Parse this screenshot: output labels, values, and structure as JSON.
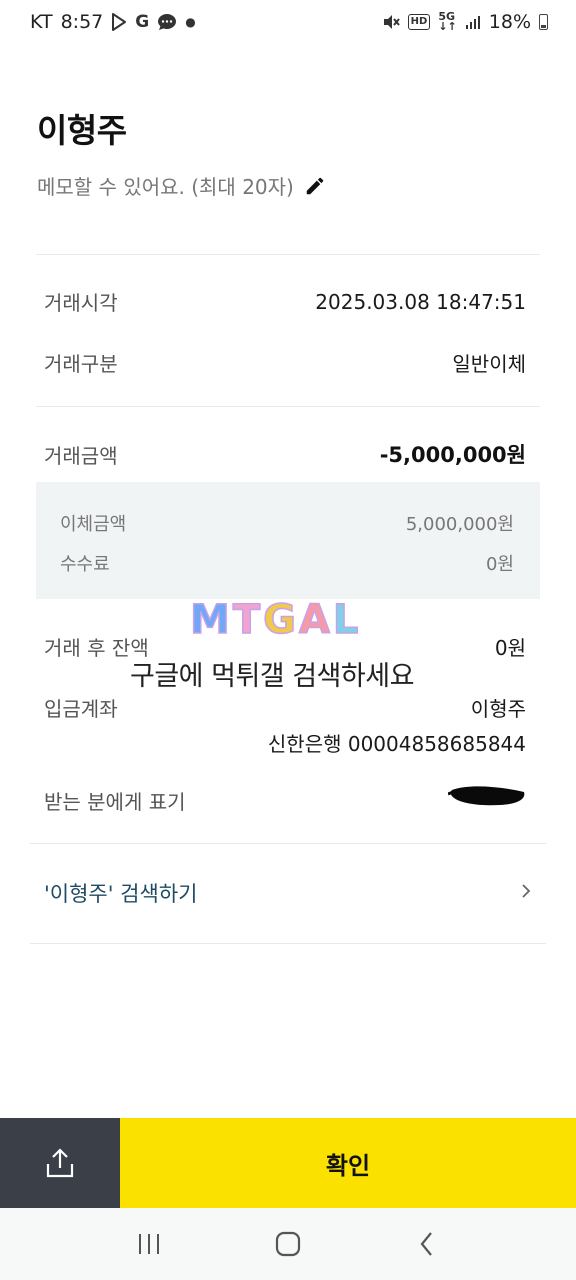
{
  "status_bar": {
    "carrier": "KT",
    "time": "8:57",
    "battery": "18%",
    "left_icons": [
      "play-store-icon",
      "google-icon",
      "message-icon"
    ],
    "right_icons": [
      "mute-icon",
      "hd-icon",
      "5g-icon",
      "signal-icon",
      "battery-icon"
    ]
  },
  "header": {
    "name": "이형주",
    "memo_placeholder": "메모할 수 있어요. (최대 20자)"
  },
  "details": {
    "time_label": "거래시각",
    "time_value": "2025.03.08 18:47:51",
    "type_label": "거래구분",
    "type_value": "일반이체",
    "amount_label": "거래금액",
    "amount_value": "-5,000,000원",
    "transfer_label": "이체금액",
    "transfer_value": "5,000,000원",
    "fee_label": "수수료",
    "fee_value": "0원",
    "balance_label": "거래 후 잔액",
    "balance_value": "0원",
    "account_label": "입금계좌",
    "account_name": "이형주",
    "account_number": "신한은행 00004858685844",
    "display_label": "받는 분에게 표기"
  },
  "search_link": {
    "label": "'이형주' 검색하기"
  },
  "watermark": {
    "logo": "MTGAL",
    "text": "구글에 먹튀갤 검색하세요"
  },
  "actions": {
    "confirm_label": "확인"
  },
  "colors": {
    "confirm": "#fae100",
    "share": "#3a3f48",
    "link": "#1f4b63",
    "sub_box": "#f1f4f4"
  }
}
